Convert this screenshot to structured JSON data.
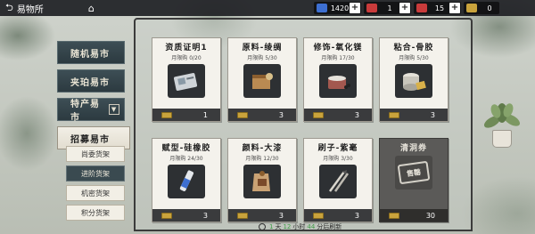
{
  "topbar": {
    "back_label": "易物所",
    "currencies": [
      {
        "name": "blue-currency",
        "value": "1420",
        "color": "#3d6fd1"
      },
      {
        "name": "red-currency",
        "value": "1",
        "color": "#c93b3b"
      },
      {
        "name": "red-ticket-currency",
        "value": "15",
        "color": "#c93b3b"
      },
      {
        "name": "gold-currency",
        "value": "0",
        "color": "#c9a33c"
      }
    ],
    "plus": "+"
  },
  "sidebar": {
    "items": [
      {
        "label": "随机易市"
      },
      {
        "label": "夹珀易市"
      },
      {
        "label": "特产易市",
        "dropdown": "▼"
      },
      {
        "label": "招募易市",
        "active": true
      }
    ],
    "sub_items": [
      {
        "label": "尚委货架"
      },
      {
        "label": "进阶货架",
        "selected": true
      },
      {
        "label": "机密货架"
      },
      {
        "label": "积分货架"
      }
    ]
  },
  "cards": [
    {
      "title": "资质证明1",
      "limit": "月限购 0/20",
      "price": "1",
      "icon": "credential-item-icon"
    },
    {
      "title": "原料-绫绸",
      "limit": "月限购 5/30",
      "price": "3",
      "icon": "silk-fabric-icon"
    },
    {
      "title": "修饰-氧化镁",
      "limit": "月限购 17/30",
      "price": "3",
      "icon": "magnesium-oxide-icon"
    },
    {
      "title": "粘合-骨胶",
      "limit": "月限购 5/30",
      "price": "3",
      "icon": "bone-glue-icon"
    },
    {
      "title": "赋型-硅橡胶",
      "limit": "月限购 24/30",
      "price": "3",
      "icon": "silicone-rubber-icon"
    },
    {
      "title": "颜料-大漆",
      "limit": "月限购 12/30",
      "price": "3",
      "icon": "lacquer-paint-icon"
    },
    {
      "title": "刷子-紫毫",
      "limit": "月限购 3/30",
      "price": "3",
      "icon": "brush-icon"
    },
    {
      "title": "清洞券",
      "limit": "",
      "price": "30",
      "icon": "ticket-icon",
      "sold_out": true,
      "stamp": "售罄"
    }
  ],
  "refresh": {
    "prefix": "",
    "days": "1",
    "days_unit": "天",
    "hours": "12",
    "hours_unit": "小时",
    "minutes": "44",
    "minutes_unit": "分后刷新"
  }
}
